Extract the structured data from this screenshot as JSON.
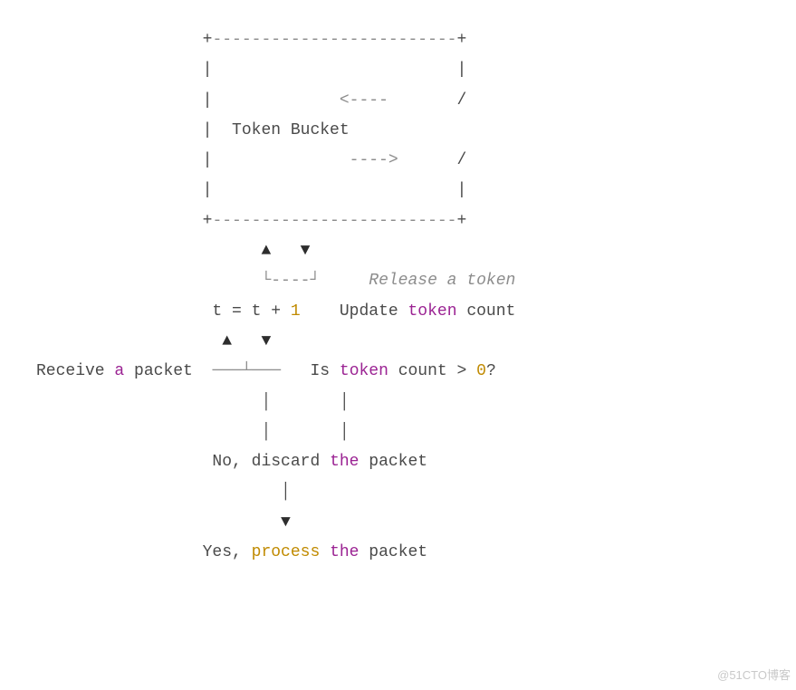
{
  "lines": [
    {
      "segs": [
        {
          "cls": "c-default",
          "t": "                 +"
        },
        {
          "cls": "c-gray",
          "t": "-------------------------"
        },
        {
          "cls": "c-default",
          "t": "+"
        }
      ]
    },
    {
      "segs": [
        {
          "cls": "c-default",
          "t": "                 |                         |"
        }
      ]
    },
    {
      "segs": [
        {
          "cls": "c-default",
          "t": "                 |             "
        },
        {
          "cls": "c-gray",
          "t": "<----"
        },
        {
          "cls": "c-default",
          "t": "       /"
        }
      ]
    },
    {
      "segs": [
        {
          "cls": "c-default",
          "t": "                 |  Token Bucket           "
        }
      ]
    },
    {
      "segs": [
        {
          "cls": "c-default",
          "t": "                 |              "
        },
        {
          "cls": "c-gray",
          "t": "---->"
        },
        {
          "cls": "c-default",
          "t": "      /"
        }
      ]
    },
    {
      "segs": [
        {
          "cls": "c-default",
          "t": "                 |                         |"
        }
      ]
    },
    {
      "segs": [
        {
          "cls": "c-default",
          "t": "                 +"
        },
        {
          "cls": "c-gray",
          "t": "-------------------------"
        },
        {
          "cls": "c-default",
          "t": "+"
        }
      ]
    },
    {
      "segs": [
        {
          "cls": "c-black",
          "t": "                       ▲   ▼"
        }
      ]
    },
    {
      "segs": [
        {
          "cls": "c-gray",
          "t": "                       └----┘     "
        },
        {
          "cls": "c-italic",
          "t": "Release a token"
        }
      ]
    },
    {
      "segs": [
        {
          "cls": "c-default",
          "t": "                  t = t + "
        },
        {
          "cls": "c-orange",
          "t": "1"
        },
        {
          "cls": "c-default",
          "t": "    Update "
        },
        {
          "cls": "c-purple",
          "t": "token"
        },
        {
          "cls": "c-default",
          "t": " count"
        }
      ]
    },
    {
      "segs": [
        {
          "cls": "c-black",
          "t": "                   ▲   ▼"
        }
      ]
    },
    {
      "segs": [
        {
          "cls": "c-default",
          "t": "Receive "
        },
        {
          "cls": "c-purple",
          "t": "a"
        },
        {
          "cls": "c-default",
          "t": " packet  "
        },
        {
          "cls": "c-gray",
          "t": "───┴───"
        },
        {
          "cls": "c-default",
          "t": "   Is "
        },
        {
          "cls": "c-purple",
          "t": "token"
        },
        {
          "cls": "c-default",
          "t": " count > "
        },
        {
          "cls": "c-orange",
          "t": "0"
        },
        {
          "cls": "c-default",
          "t": "?"
        }
      ]
    },
    {
      "segs": [
        {
          "cls": "c-default",
          "t": "                       │       │"
        }
      ]
    },
    {
      "segs": [
        {
          "cls": "c-default",
          "t": "                       │       │"
        }
      ]
    },
    {
      "segs": [
        {
          "cls": "c-default",
          "t": "                  No, discard "
        },
        {
          "cls": "c-purple",
          "t": "the"
        },
        {
          "cls": "c-default",
          "t": " packet"
        }
      ]
    },
    {
      "segs": [
        {
          "cls": "c-default",
          "t": "                         │"
        }
      ]
    },
    {
      "segs": [
        {
          "cls": "c-black",
          "t": "                         ▼"
        }
      ]
    },
    {
      "segs": [
        {
          "cls": "c-default",
          "t": "                 Yes, "
        },
        {
          "cls": "c-orange",
          "t": "process"
        },
        {
          "cls": "c-default",
          "t": " "
        },
        {
          "cls": "c-purple",
          "t": "the"
        },
        {
          "cls": "c-default",
          "t": " packet"
        }
      ]
    }
  ],
  "arrows": {
    "up": "▲",
    "down": "▼"
  },
  "watermark": "@51CTO博客"
}
